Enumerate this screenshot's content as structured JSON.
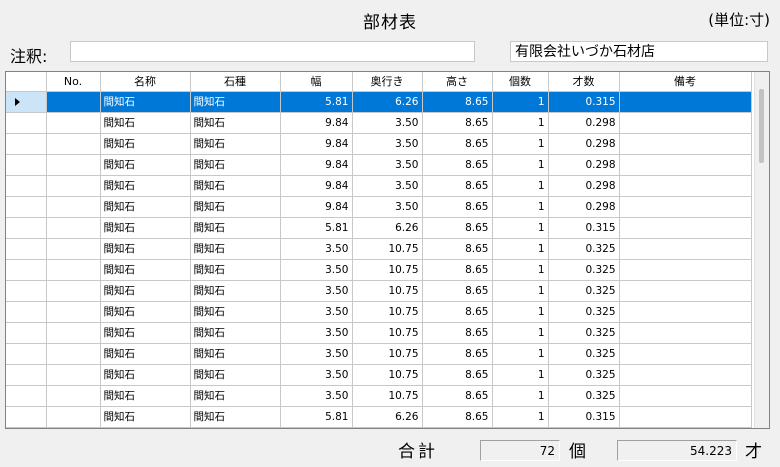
{
  "header": {
    "title": "部材表",
    "unit": "(単位:寸)",
    "note_label": "注釈:",
    "note_value": "",
    "company": "有限会社いづか石材店"
  },
  "columns": [
    "No.",
    "名称",
    "石種",
    "幅",
    "奥行き",
    "高さ",
    "個数",
    "才数",
    "備考"
  ],
  "rows": [
    {
      "no": "",
      "name": "間知石",
      "stone": "間知石",
      "width": "5.81",
      "depth": "6.26",
      "height": "8.65",
      "count": "1",
      "size": "0.315",
      "note": ""
    },
    {
      "no": "",
      "name": "間知石",
      "stone": "間知石",
      "width": "9.84",
      "depth": "3.50",
      "height": "8.65",
      "count": "1",
      "size": "0.298",
      "note": ""
    },
    {
      "no": "",
      "name": "間知石",
      "stone": "間知石",
      "width": "9.84",
      "depth": "3.50",
      "height": "8.65",
      "count": "1",
      "size": "0.298",
      "note": ""
    },
    {
      "no": "",
      "name": "間知石",
      "stone": "間知石",
      "width": "9.84",
      "depth": "3.50",
      "height": "8.65",
      "count": "1",
      "size": "0.298",
      "note": ""
    },
    {
      "no": "",
      "name": "間知石",
      "stone": "間知石",
      "width": "9.84",
      "depth": "3.50",
      "height": "8.65",
      "count": "1",
      "size": "0.298",
      "note": ""
    },
    {
      "no": "",
      "name": "間知石",
      "stone": "間知石",
      "width": "9.84",
      "depth": "3.50",
      "height": "8.65",
      "count": "1",
      "size": "0.298",
      "note": ""
    },
    {
      "no": "",
      "name": "間知石",
      "stone": "間知石",
      "width": "5.81",
      "depth": "6.26",
      "height": "8.65",
      "count": "1",
      "size": "0.315",
      "note": ""
    },
    {
      "no": "",
      "name": "間知石",
      "stone": "間知石",
      "width": "3.50",
      "depth": "10.75",
      "height": "8.65",
      "count": "1",
      "size": "0.325",
      "note": ""
    },
    {
      "no": "",
      "name": "間知石",
      "stone": "間知石",
      "width": "3.50",
      "depth": "10.75",
      "height": "8.65",
      "count": "1",
      "size": "0.325",
      "note": ""
    },
    {
      "no": "",
      "name": "間知石",
      "stone": "間知石",
      "width": "3.50",
      "depth": "10.75",
      "height": "8.65",
      "count": "1",
      "size": "0.325",
      "note": ""
    },
    {
      "no": "",
      "name": "間知石",
      "stone": "間知石",
      "width": "3.50",
      "depth": "10.75",
      "height": "8.65",
      "count": "1",
      "size": "0.325",
      "note": ""
    },
    {
      "no": "",
      "name": "間知石",
      "stone": "間知石",
      "width": "3.50",
      "depth": "10.75",
      "height": "8.65",
      "count": "1",
      "size": "0.325",
      "note": ""
    },
    {
      "no": "",
      "name": "間知石",
      "stone": "間知石",
      "width": "3.50",
      "depth": "10.75",
      "height": "8.65",
      "count": "1",
      "size": "0.325",
      "note": ""
    },
    {
      "no": "",
      "name": "間知石",
      "stone": "間知石",
      "width": "3.50",
      "depth": "10.75",
      "height": "8.65",
      "count": "1",
      "size": "0.325",
      "note": ""
    },
    {
      "no": "",
      "name": "間知石",
      "stone": "間知石",
      "width": "3.50",
      "depth": "10.75",
      "height": "8.65",
      "count": "1",
      "size": "0.325",
      "note": ""
    },
    {
      "no": "",
      "name": "間知石",
      "stone": "間知石",
      "width": "5.81",
      "depth": "6.26",
      "height": "8.65",
      "count": "1",
      "size": "0.315",
      "note": ""
    }
  ],
  "selected_row": 0,
  "icons": {
    "row_indicator": "row-indicator-arrow-icon"
  },
  "footer": {
    "total_label": "合計",
    "count_total": "72",
    "count_unit": "個",
    "size_total": "54.223",
    "size_unit": "才"
  },
  "colors": {
    "selection": "#0078d7",
    "indicator_cell": "#cce4f7",
    "grid_line": "#c8c8c8"
  }
}
